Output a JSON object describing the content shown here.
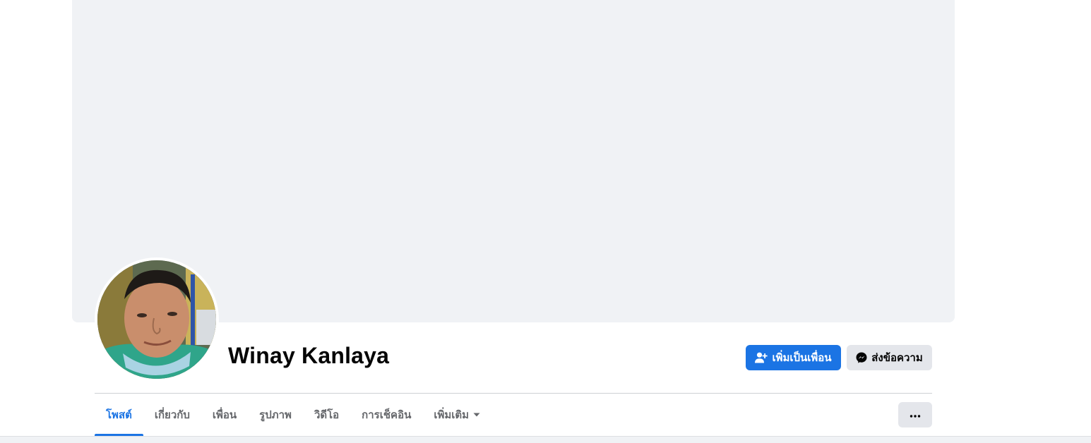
{
  "profile": {
    "name": "Winay Kanlaya",
    "avatar_icon": "profile-photo"
  },
  "actions": {
    "add_friend_label": "เพิ่มเป็นเพื่อน",
    "add_friend_icon": "person-add-icon",
    "message_label": "ส่งข้อความ",
    "message_icon": "messenger-icon",
    "more_icon": "ellipsis-icon"
  },
  "tabs": [
    {
      "label": "โพสต์",
      "active": true
    },
    {
      "label": "เกี่ยวกับ",
      "active": false
    },
    {
      "label": "เพื่อน",
      "active": false
    },
    {
      "label": "รูปภาพ",
      "active": false
    },
    {
      "label": "วิดีโอ",
      "active": false
    },
    {
      "label": "การเช็คอิน",
      "active": false
    },
    {
      "label": "เพิ่มเติม",
      "active": false
    }
  ],
  "colors": {
    "accent": "#1b74e4",
    "cover_bg": "#f0f2f5",
    "secondary_button": "#e4e6eb",
    "tab_text": "#65676b"
  }
}
